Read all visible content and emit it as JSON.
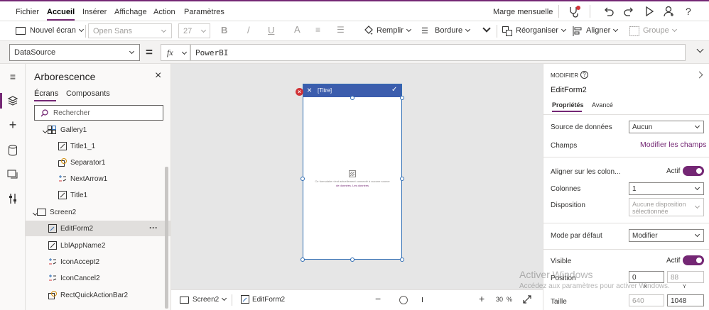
{
  "menu": {
    "items": [
      "Fichier",
      "Accueil",
      "Insérer",
      "Affichage",
      "Action",
      "Paramètres"
    ],
    "right_label": "Marge mensuelle"
  },
  "toolbar": {
    "new_screen": "Nouvel écran",
    "font": "Open Sans",
    "font_size": "27",
    "bold": "B",
    "italic": "/",
    "underline": "U",
    "fill": "Remplir",
    "border": "Bordure",
    "reorder": "Réorganiser",
    "align": "Aligner",
    "group": "Groupe"
  },
  "formula": {
    "property": "DataSource",
    "equals": "=",
    "fx": "fx",
    "value": "PowerBI"
  },
  "tree": {
    "title": "Arborescence",
    "tab_screens": "Écrans",
    "tab_components": "Composants",
    "search_placeholder": "Rechercher",
    "items": [
      {
        "label": "Gallery1"
      },
      {
        "label": "Title1_1"
      },
      {
        "label": "Separator1"
      },
      {
        "label": "NextArrow1"
      },
      {
        "label": "Title1"
      },
      {
        "label": "Screen2"
      },
      {
        "label": "EditForm2"
      },
      {
        "label": "LblAppName2"
      },
      {
        "label": "IconAccept2"
      },
      {
        "label": "IconCancel2"
      },
      {
        "label": "RectQuickActionBar2"
      }
    ],
    "more": "···"
  },
  "canvas": {
    "title": "[Titre]",
    "placeholder_line1": "Ce formulaire n'est actuellement connecté à aucune source",
    "placeholder_line2": "de données. Les données"
  },
  "status": {
    "screen": "Screen2",
    "control": "EditForm2",
    "zoom": "30",
    "percent": "%"
  },
  "props": {
    "header": "MODIFIER",
    "control_name": "EditForm2",
    "tab_properties": "Propriétés",
    "tab_advanced": "Avancé",
    "data_source_label": "Source de données",
    "data_source_value": "Aucun",
    "fields_label": "Champs",
    "fields_link": "Modifier les champs",
    "snap_label": "Aligner sur les colon...",
    "snap_state": "Actif",
    "columns_label": "Colonnes",
    "columns_value": "1",
    "layout_label": "Disposition",
    "layout_value": "Aucune disposition sélectionnée",
    "mode_label": "Mode par défaut",
    "mode_value": "Modifier",
    "visible_label": "Visible",
    "visible_state": "Actif",
    "position_label": "Position",
    "pos_x": "0",
    "pos_y": "88",
    "x_label": "X",
    "y_label": "Y",
    "size_label": "Taille",
    "width": "640",
    "height": "1048"
  },
  "watermark": {
    "line1": "Activer Windows",
    "line2": "Accédez aux paramètres pour activer Windows."
  },
  "colors": {
    "accent": "#742774",
    "form_header": "#3c5dad",
    "link": "#742774"
  }
}
